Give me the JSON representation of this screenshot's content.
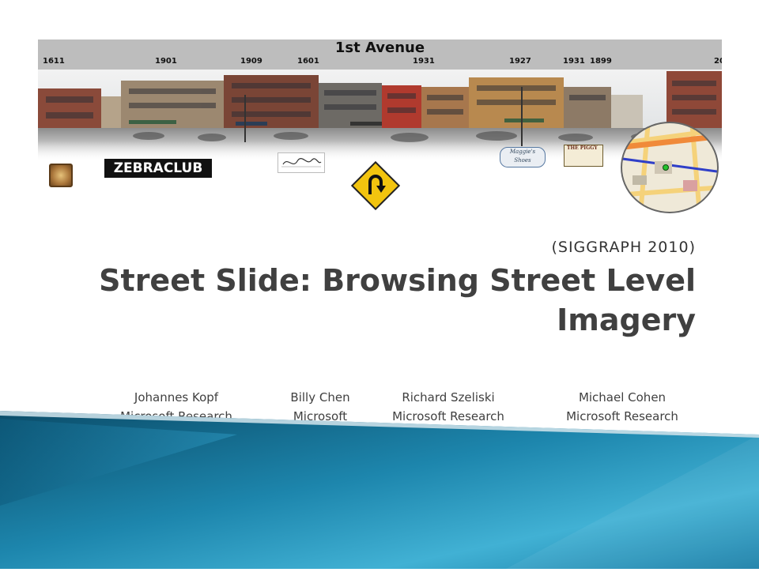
{
  "banner": {
    "street_name": "1st Avenue",
    "addresses": [
      "1611",
      "1901",
      "1909",
      "1601",
      "1931",
      "1927",
      "1931",
      "1899",
      "20"
    ]
  },
  "logos": {
    "zebraclub": "ZEBRACLUB",
    "maggies_line1": "Maggie's",
    "maggies_line2": "Shoes",
    "pub_text": "THE PIGGY"
  },
  "slide": {
    "conference": "(SIGGRAPH 2010)",
    "title": "Street Slide: Browsing Street Level Imagery"
  },
  "authors": [
    {
      "name": "Johannes Kopf",
      "affiliation": "Microsoft Research"
    },
    {
      "name": "Billy Chen",
      "affiliation": "Microsoft"
    },
    {
      "name": "Richard Szeliski",
      "affiliation": "Microsoft Research"
    },
    {
      "name": "Michael Cohen",
      "affiliation": "Microsoft Research"
    }
  ],
  "colors": {
    "title_text": "#404040",
    "deco_teal_dark": "#0b4d6a",
    "deco_teal_light": "#3aa6c9",
    "sign_yellow": "#f2c40f"
  }
}
